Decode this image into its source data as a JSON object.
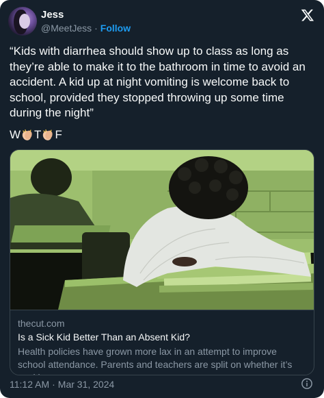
{
  "author": {
    "name": "Jess",
    "handle": "@MeetJess",
    "separator": "·",
    "follow_label": "Follow",
    "avatar_icon": "user-avatar"
  },
  "platform_icon": "x-logo-icon",
  "tweet": {
    "text": "“Kids with diarrhea should show up to class as long as they’re able to make it to the bathroom in time to avoid an accident. A kid up at night vomiting is welcome back to school, provided they stopped throwing up some time during the night”",
    "reaction": {
      "letter_1": "W",
      "letter_2": "T",
      "letter_3": "F",
      "emoji": "clapping-hands-icon"
    }
  },
  "link_card": {
    "domain": "thecut.com",
    "title": "Is a Sick Kid Better Than an Absent Kid?",
    "description": "Health policies have grown more lax in an attempt to improve school attendance. Parents and teachers are split on whether it’s working.",
    "image_icon": "classroom-photo"
  },
  "footer": {
    "time": "11:12 AM",
    "separator": "·",
    "date": "Mar 31, 2024",
    "info_icon": "info-icon"
  },
  "colors": {
    "background": "#15202b",
    "text": "#f7f9f9",
    "muted": "#8b98a5",
    "accent": "#1d9bf0",
    "border": "#38444d",
    "photo_tint": "#a8c97a"
  }
}
